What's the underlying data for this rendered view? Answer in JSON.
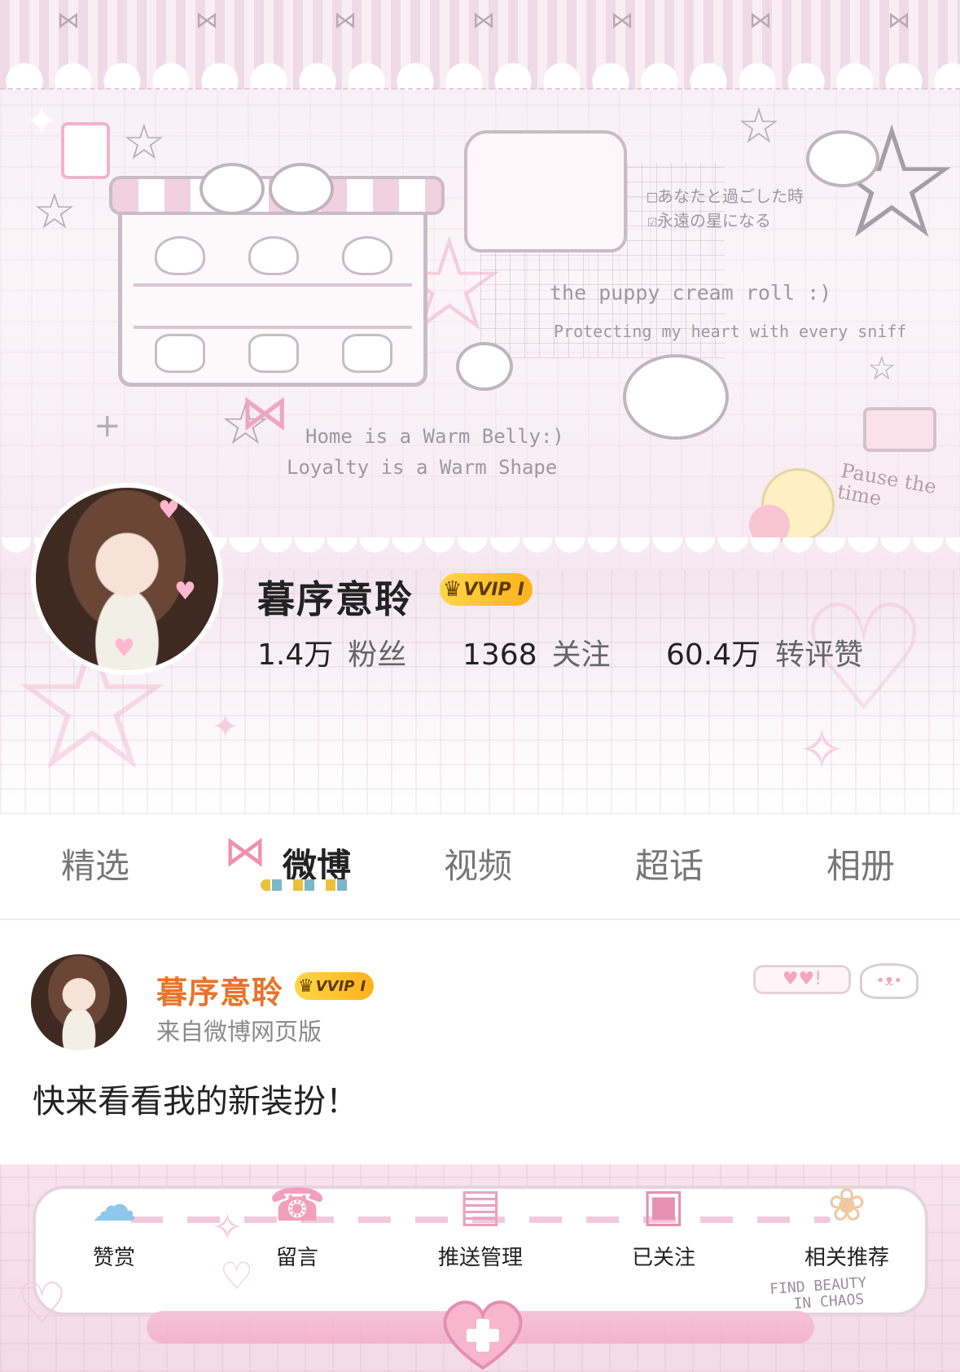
{
  "banner": {
    "handwriting_1": "Home is a Warm Belly:)",
    "handwriting_2": "Loyalty is a Warm Shape",
    "puppy_title": "the puppy cream roll :)",
    "puppy_subtitle": "Protecting my heart with every sniff",
    "jp_line_1": "□あなたと過ごした時",
    "jp_line_2": "☑永遠の星になる",
    "pause_badge": "Pause the time"
  },
  "profile": {
    "name": "暮序意聆",
    "badge": "VVIP",
    "badge_level": "I",
    "stats": [
      {
        "value": "1.4万",
        "label": "粉丝"
      },
      {
        "value": "1368",
        "label": "关注"
      },
      {
        "value": "60.4万",
        "label": "转评赞"
      }
    ]
  },
  "tabs": [
    {
      "label": "精选",
      "active": false
    },
    {
      "label": "微博",
      "active": true
    },
    {
      "label": "视频",
      "active": false
    },
    {
      "label": "超话",
      "active": false
    },
    {
      "label": "相册",
      "active": false
    }
  ],
  "post": {
    "author": "暮序意聆",
    "badge": "VVIP",
    "badge_level": "I",
    "source": "来自微博网页版",
    "text": "快来看看我的新装扮！",
    "deco": "♥♥!"
  },
  "actions": [
    {
      "label": "赞赏",
      "icon": "rainbow-icon"
    },
    {
      "label": "留言",
      "icon": "telephone-icon"
    },
    {
      "label": "推送管理",
      "icon": "book-stack-icon"
    },
    {
      "label": "已关注",
      "icon": "game-console-icon"
    },
    {
      "label": "相关推荐",
      "icon": "bear-in-cap-icon"
    }
  ],
  "footer": {
    "find_beauty_1": "FIND BEAUTY",
    "find_beauty_2": "IN CHAOS"
  },
  "colors": {
    "accent_orange": "#e8732a",
    "badge_gold": "#ffc42e",
    "pink": "#f3aec8"
  }
}
